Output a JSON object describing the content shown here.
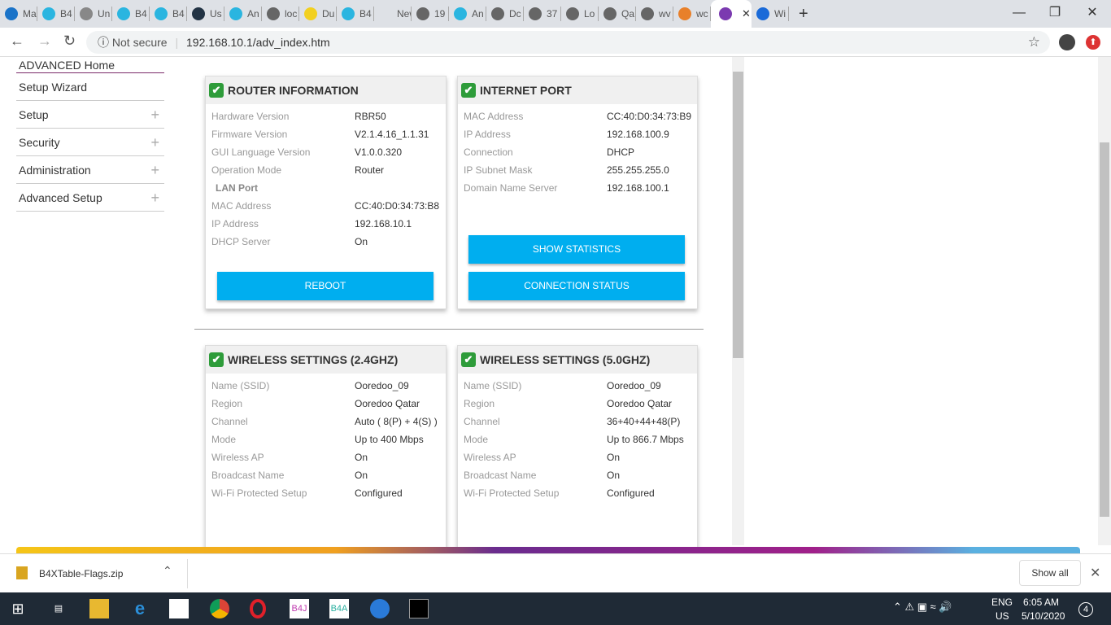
{
  "browser": {
    "tabs": [
      "Ma",
      "B4",
      "Un",
      "B4",
      "B4",
      "Us",
      "An",
      "loc",
      "Du",
      "B4",
      "New Ta",
      "19",
      "An",
      "Dc",
      "37",
      "Lo",
      "Qa",
      "wv",
      "wc",
      "",
      "Wi"
    ],
    "active_tab": 19,
    "url_security": "Not secure",
    "url": "192.168.10.1/adv_index.htm"
  },
  "sidebar": {
    "items": [
      {
        "label": "ADVANCED Home",
        "expand": false
      },
      {
        "label": "Setup Wizard",
        "expand": false
      },
      {
        "label": "Setup",
        "expand": true
      },
      {
        "label": "Security",
        "expand": true
      },
      {
        "label": "Administration",
        "expand": true
      },
      {
        "label": "Advanced Setup",
        "expand": true
      }
    ]
  },
  "panels": {
    "router": {
      "title": "ROUTER INFORMATION",
      "rows": [
        [
          "Hardware Version",
          "RBR50"
        ],
        [
          "Firmware Version",
          "V2.1.4.16_1.1.31"
        ],
        [
          "GUI Language Version",
          "V1.0.0.320"
        ],
        [
          "Operation Mode",
          "Router"
        ]
      ],
      "sub": "LAN Port",
      "rows2": [
        [
          "MAC Address",
          "CC:40:D0:34:73:B8"
        ],
        [
          "IP Address",
          "192.168.10.1"
        ],
        [
          "DHCP Server",
          "On"
        ]
      ],
      "button": "REBOOT"
    },
    "internet": {
      "title": "INTERNET PORT",
      "rows": [
        [
          "MAC Address",
          "CC:40:D0:34:73:B9"
        ],
        [
          "IP Address",
          "192.168.100.9"
        ],
        [
          "Connection",
          "DHCP"
        ],
        [
          "IP Subnet Mask",
          "255.255.255.0"
        ],
        [
          "Domain Name Server",
          "192.168.100.1"
        ]
      ],
      "buttons": [
        "SHOW STATISTICS",
        "CONNECTION STATUS"
      ]
    },
    "wifi24": {
      "title": "WIRELESS SETTINGS (2.4GHZ)",
      "rows": [
        [
          "Name (SSID)",
          "Ooredoo_09"
        ],
        [
          "Region",
          "Ooredoo Qatar"
        ],
        [
          "Channel",
          "Auto ( 8(P) + 4(S) )"
        ],
        [
          "Mode",
          "Up to 400 Mbps"
        ],
        [
          "Wireless AP",
          "On"
        ],
        [
          "Broadcast Name",
          "On"
        ],
        [
          "Wi-Fi Protected Setup",
          "Configured"
        ]
      ]
    },
    "wifi50": {
      "title": "WIRELESS SETTINGS (5.0GHZ)",
      "rows": [
        [
          "Name (SSID)",
          "Ooredoo_09"
        ],
        [
          "Region",
          "Ooredoo Qatar"
        ],
        [
          "Channel",
          "36+40+44+48(P)"
        ],
        [
          "Mode",
          "Up to 866.7 Mbps"
        ],
        [
          "Wireless AP",
          "On"
        ],
        [
          "Broadcast Name",
          "On"
        ],
        [
          "Wi-Fi Protected Setup",
          "Configured"
        ]
      ]
    }
  },
  "download": {
    "file": "B4XTable-Flags.zip",
    "show_all": "Show all"
  },
  "taskbar": {
    "apps": [
      "B4J",
      "B4A"
    ],
    "lang": "ENG",
    "region": "US",
    "time": "6:05 AM",
    "date": "5/10/2020",
    "notifications": "4"
  }
}
